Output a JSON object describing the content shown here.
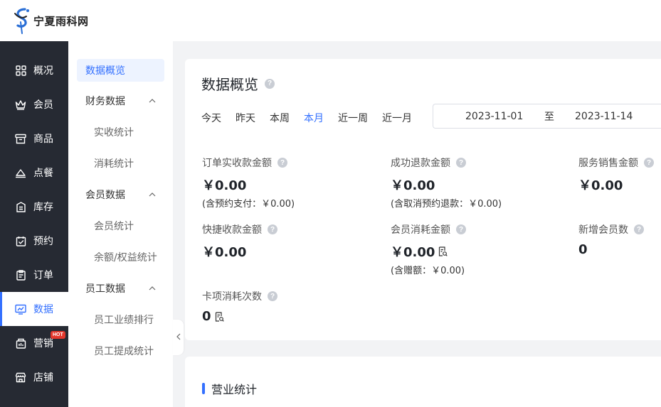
{
  "header": {
    "logo_text": "宁夏雨科网"
  },
  "sidebar": {
    "items": [
      {
        "label": "概况",
        "icon": "grid-icon"
      },
      {
        "label": "会员",
        "icon": "crown-icon"
      },
      {
        "label": "商品",
        "icon": "store-box-icon"
      },
      {
        "label": "点餐",
        "icon": "dish-cover-icon"
      },
      {
        "label": "库存",
        "icon": "inventory-icon"
      },
      {
        "label": "预约",
        "icon": "calendar-check-icon"
      },
      {
        "label": "订单",
        "icon": "clipboard-icon"
      },
      {
        "label": "数据",
        "icon": "chart-monitor-icon"
      },
      {
        "label": "营销",
        "icon": "marketing-icon",
        "badge": "HOT"
      },
      {
        "label": "店铺",
        "icon": "shop-icon"
      }
    ],
    "active": "数据",
    "accent": "#3370ff"
  },
  "submenu": {
    "overview": "数据概览",
    "finance_group": "财务数据",
    "finance_items": [
      "实收统计",
      "消耗统计"
    ],
    "member_group": "会员数据",
    "member_items": [
      "会员统计",
      "余额/权益统计"
    ],
    "staff_group": "员工数据",
    "staff_items": [
      "员工业绩排行",
      "员工提成统计"
    ]
  },
  "overview": {
    "title": "数据概览",
    "ranges": [
      "今天",
      "昨天",
      "本周",
      "本月",
      "近一周",
      "近一月"
    ],
    "active_range": "本月",
    "date_start": "2023-11-01",
    "date_separator": "至",
    "date_end": "2023-11-14",
    "stats": {
      "order_received": {
        "label": "订单实收款金额",
        "value": "￥0.00",
        "sub": "(含预约支付：￥0.00)"
      },
      "refund": {
        "label": "成功退款金额",
        "value": "￥0.00",
        "sub": "(含取消预约退款：￥0.00)"
      },
      "service_sales": {
        "label": "服务销售金额",
        "value": "￥0.00"
      },
      "quick_receipt": {
        "label": "快捷收款金额",
        "value": "￥0.00"
      },
      "member_consumption": {
        "label": "会员消耗金额",
        "value": "￥0.00",
        "sub": "(含赠额：￥0.00)"
      },
      "new_members": {
        "label": "新增会员数",
        "value": "0"
      },
      "card_usage": {
        "label": "卡项消耗次数",
        "value": "0"
      }
    }
  },
  "business": {
    "title": "营业统计"
  }
}
